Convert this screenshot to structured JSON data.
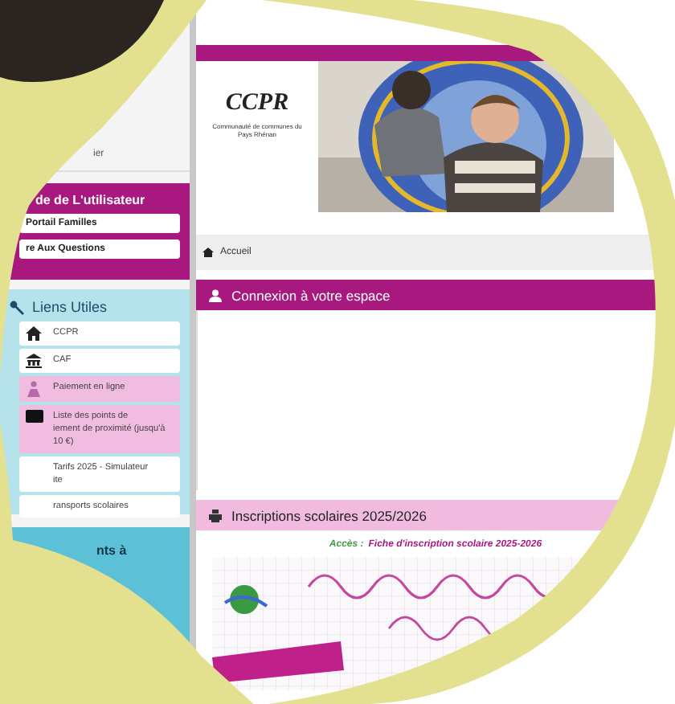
{
  "sidebar": {
    "top_item": "ier",
    "guide": {
      "title": "de de L'utilisateur",
      "buttons": [
        "Portail Familles",
        "re Aux Questions"
      ]
    },
    "links": {
      "title": "Liens Utiles",
      "items": [
        {
          "label": "CCPR",
          "kind": "home",
          "highlighted": false
        },
        {
          "label": "CAF",
          "kind": "bank",
          "highlighted": false
        },
        {
          "label": "Paiement en ligne",
          "kind": "payment",
          "highlighted": true
        },
        {
          "label": "Liste des points de\niement de proximité (jusqu'à\n10 €)",
          "kind": "card",
          "highlighted": true
        },
        {
          "label": "Tarifs 2025 - Simulateur\nite",
          "kind": "plain",
          "highlighted": false
        },
        {
          "label": "ransports scolaires",
          "kind": "plain",
          "highlighted": false
        }
      ]
    },
    "next_panel": {
      "title": "nts à"
    }
  },
  "header": {
    "logo": {
      "name": "CCPR",
      "subtitle": "Communauté de communes du Pays Rhénan"
    }
  },
  "breadcrumb": "Accueil",
  "sections": [
    {
      "kind": "login",
      "title": "Connexion à votre espace"
    },
    {
      "kind": "enrolment",
      "title": "Inscriptions scolaires 2025/2026",
      "access_label": "Accès :",
      "link": "Fiche d'inscription scolaire 2025-2026"
    }
  ]
}
